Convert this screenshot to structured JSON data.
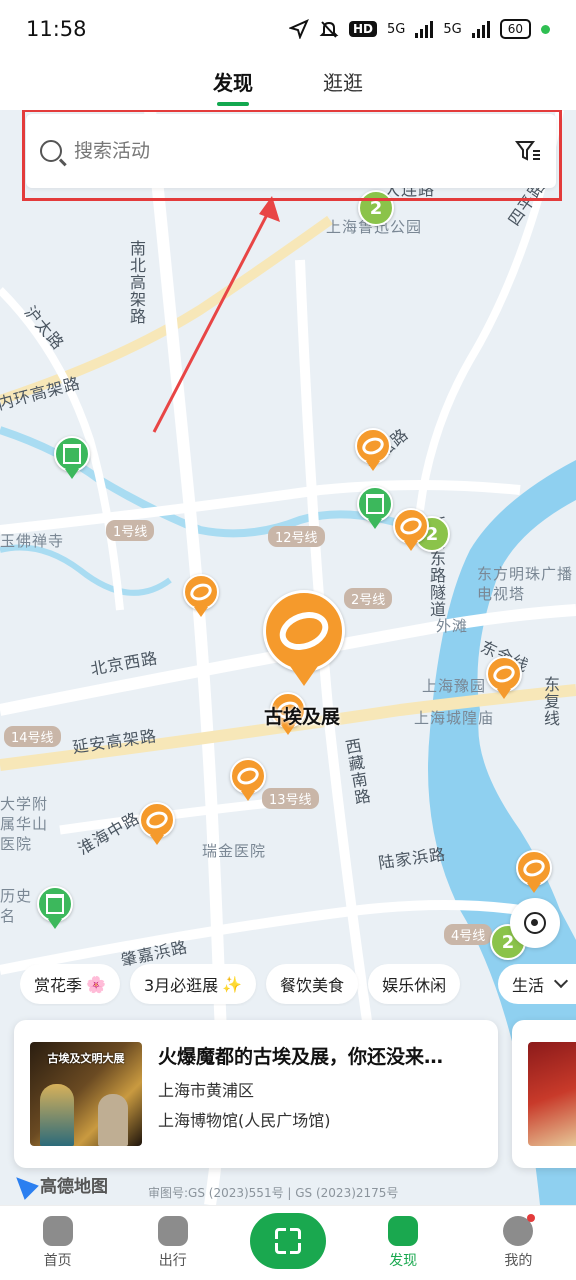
{
  "status_bar": {
    "time": "11:58",
    "hd_label": "HD",
    "net1": "5G",
    "net2": "5G",
    "battery": "60"
  },
  "tabs": [
    {
      "label": "发现",
      "active": true
    },
    {
      "label": "逛逛",
      "active": false
    }
  ],
  "search": {
    "placeholder": "搜索活动",
    "highlight_color": "#e33b3b"
  },
  "map": {
    "roads": [
      "沪太路",
      "内环高架路",
      "南北高架路",
      "北京西路",
      "延安高架路",
      "淮海中路",
      "肇嘉浜路",
      "西藏南路",
      "陆家浜路",
      "东方明珠广播电视塔",
      "外滩",
      "上海豫园",
      "上海城隍庙",
      "瑞金医院",
      "上海鲁迅公园",
      "玉佛禅寺",
      "大连路",
      "四平路",
      "东复线",
      "延安东路隧道",
      "大学附属华山医院",
      "历史名",
      "吴淞路",
      "东余线"
    ],
    "metro_lines": [
      "1号线",
      "12号线",
      "2号线",
      "14号线",
      "13号线",
      "4号线"
    ],
    "cluster_counts": [
      "2",
      "2",
      "2"
    ],
    "selected_pin_label": "古埃及展",
    "credit": "审图号:GS (2023)551号 | GS (2023)2175号",
    "logo": "高德地图"
  },
  "chips": [
    {
      "label": "赏花季",
      "emoji": "🌸"
    },
    {
      "label": "3月必逛展",
      "emoji": "✨"
    },
    {
      "label": "餐饮美食",
      "emoji": ""
    },
    {
      "label": "娱乐休闲",
      "emoji": ""
    },
    {
      "label": "生活",
      "emoji": ""
    }
  ],
  "card": {
    "title": "火爆魔都的古埃及展，你还没来…",
    "district": "上海市黄浦区",
    "venue": "上海博物馆(人民广场馆)",
    "image_caption": "古埃及文明大展"
  },
  "bottom_nav": [
    {
      "label": "首页",
      "active": false
    },
    {
      "label": "出行",
      "active": false
    },
    {
      "label": "",
      "active": false
    },
    {
      "label": "发现",
      "active": true
    },
    {
      "label": "我的",
      "active": false
    }
  ],
  "colors": {
    "brand_green": "#1aa84f",
    "pin_orange": "#f59a2c",
    "pin_green": "#3cb85c",
    "cluster_green": "#8bc34a",
    "river": "#8fd0f0"
  }
}
